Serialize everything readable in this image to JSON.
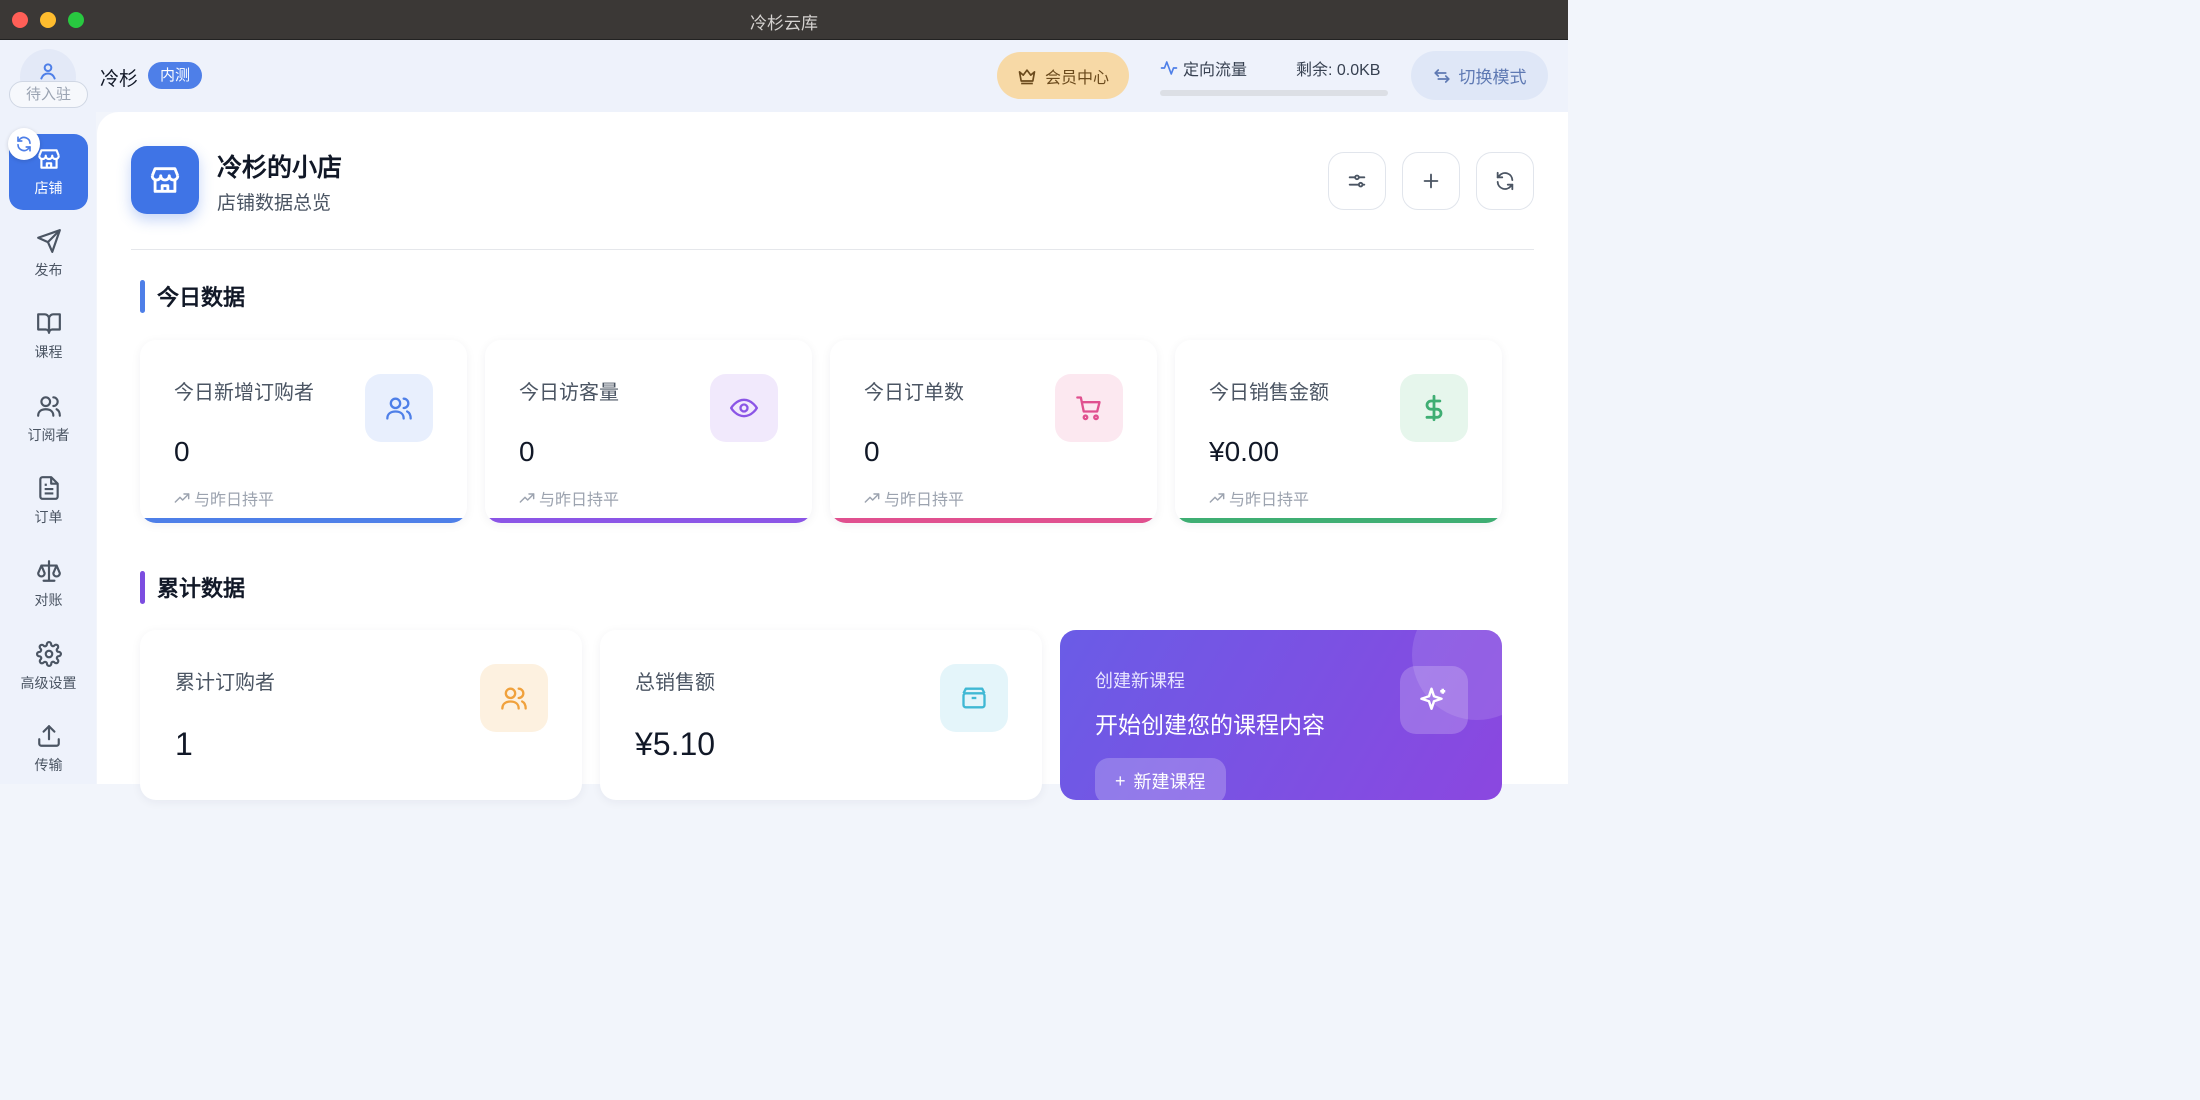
{
  "window": {
    "title": "冷杉云库"
  },
  "header": {
    "avatar_badge": "待入驻",
    "user_name": "冷杉",
    "user_tag": "内测",
    "vip_label": "会员中心",
    "traffic_label": "定向流量",
    "traffic_remaining": "剩余: 0.0KB",
    "traffic_fraction": 0,
    "mode_label": "切换模式"
  },
  "sidebar": {
    "items": [
      {
        "label": "店铺",
        "icon": "store-icon",
        "active": true
      },
      {
        "label": "发布",
        "icon": "send-icon"
      },
      {
        "label": "课程",
        "icon": "book-icon"
      },
      {
        "label": "订阅者",
        "icon": "users-icon"
      },
      {
        "label": "订单",
        "icon": "document-icon"
      },
      {
        "label": "对账",
        "icon": "scale-icon"
      },
      {
        "label": "高级设置",
        "icon": "gear-icon"
      },
      {
        "label": "传输",
        "icon": "upload-icon"
      }
    ]
  },
  "store": {
    "title": "冷杉的小店",
    "subtitle": "店铺数据总览"
  },
  "today": {
    "section_title": "今日数据",
    "cards": [
      {
        "label": "今日新增订购者",
        "value": "0",
        "trend": "与昨日持平",
        "icon": "users-icon",
        "color": "#4e7fe8"
      },
      {
        "label": "今日访客量",
        "value": "0",
        "trend": "与昨日持平",
        "icon": "eye-icon",
        "color": "#8b55e6"
      },
      {
        "label": "今日订单数",
        "value": "0",
        "trend": "与昨日持平",
        "icon": "cart-icon",
        "color": "#e0508f"
      },
      {
        "label": "今日销售金额",
        "value": "¥0.00",
        "trend": "与昨日持平",
        "icon": "dollar-icon",
        "color": "#3fae73"
      }
    ]
  },
  "total": {
    "section_title": "累计数据",
    "cards": [
      {
        "label": "累计订购者",
        "value": "1",
        "icon": "users-icon",
        "color": "#f0a13c"
      },
      {
        "label": "总销售额",
        "value": "¥5.10",
        "icon": "box-icon",
        "color": "#3fb8d4"
      }
    ],
    "create": {
      "eyebrow": "创建新课程",
      "headline": "开始创建您的课程内容",
      "button_label": "新建课程",
      "icon": "sparkles-icon"
    }
  }
}
